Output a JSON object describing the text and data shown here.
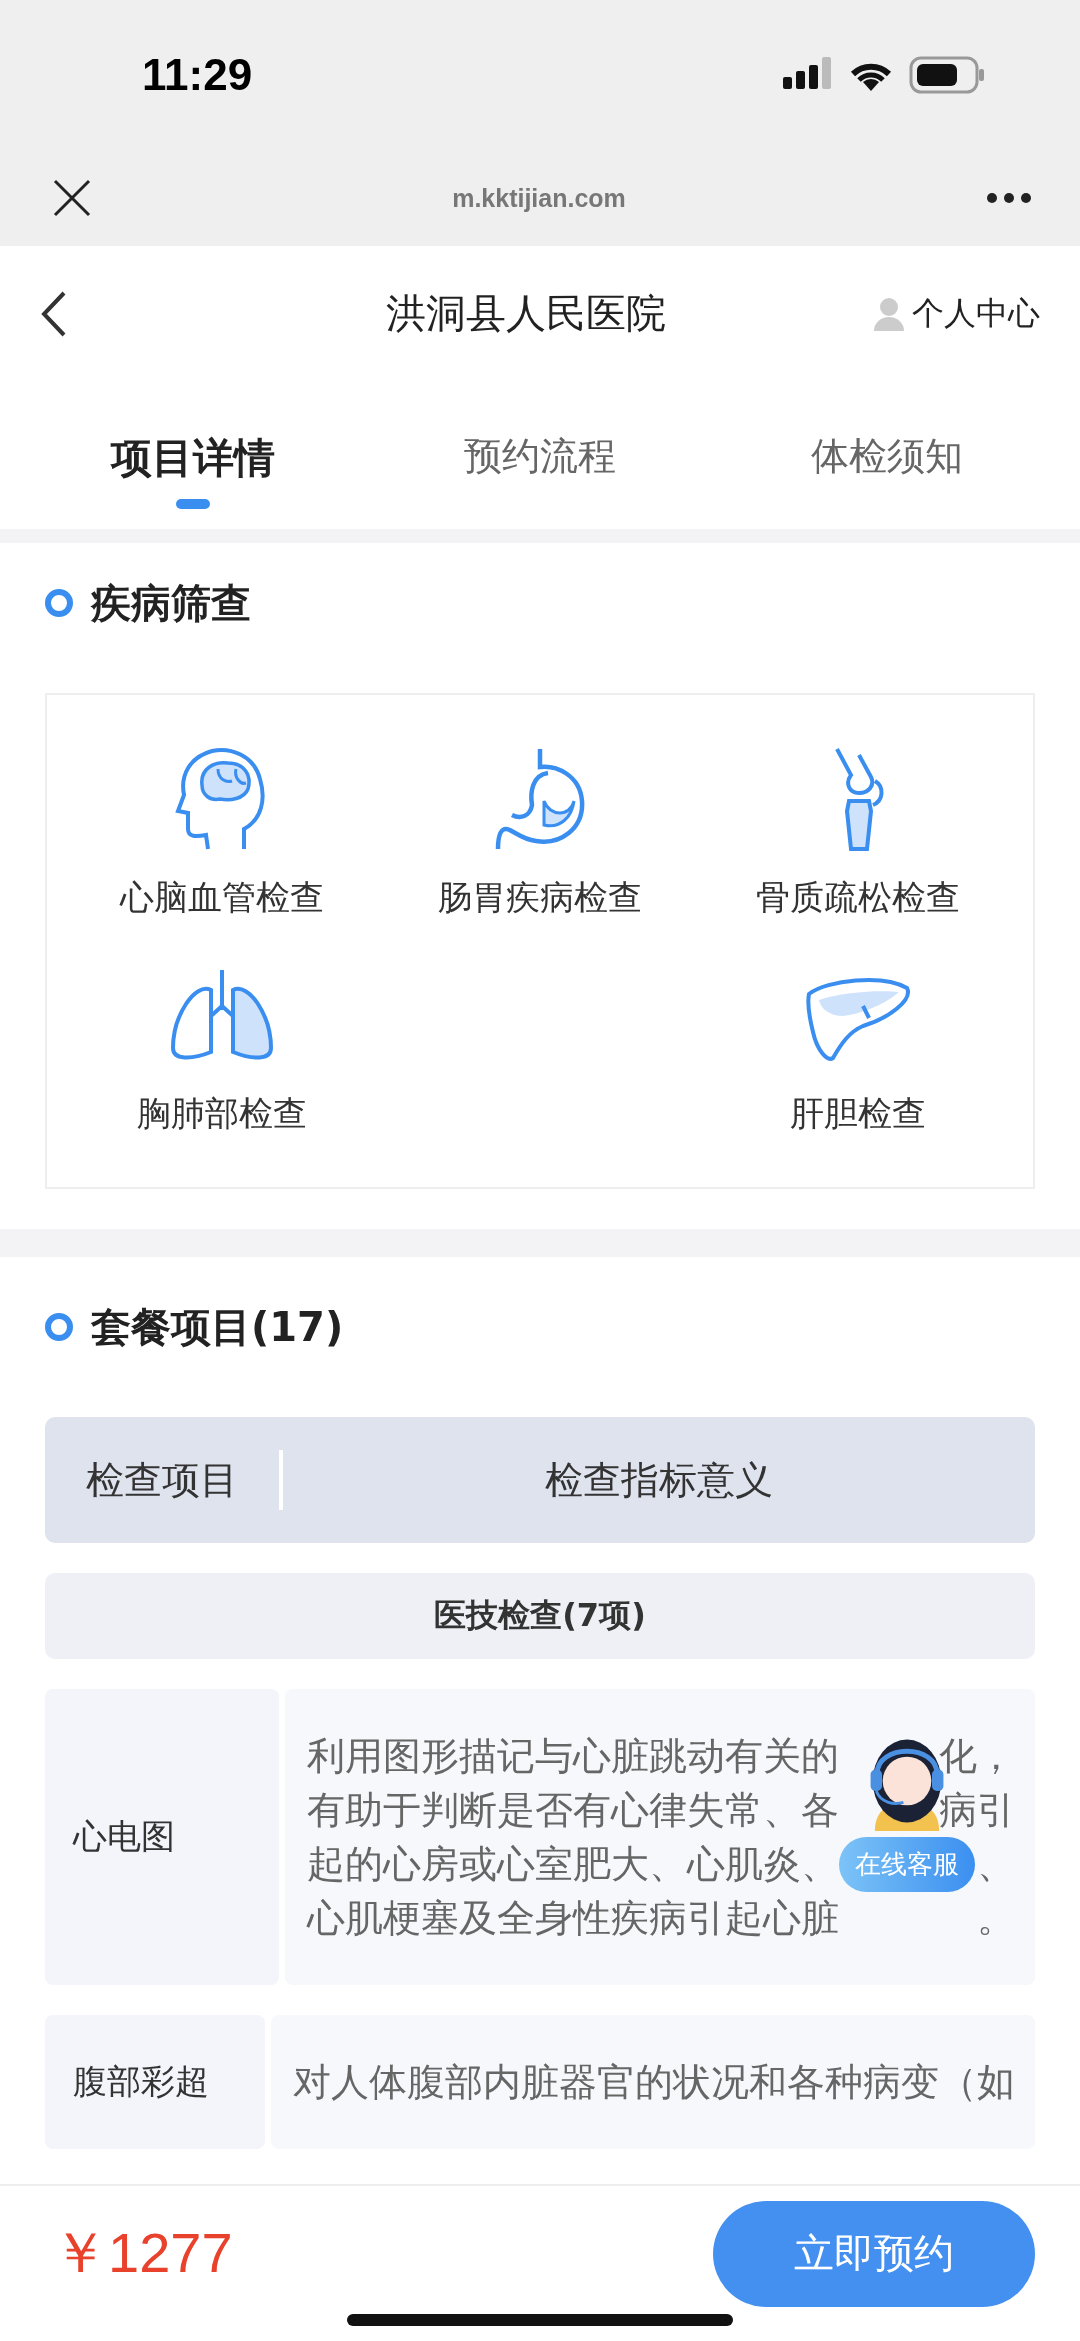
{
  "status_bar": {
    "time": "11:29"
  },
  "browser": {
    "url": "m.kktijian.com"
  },
  "header": {
    "title": "洪洞县人民医院",
    "user_link": "个人中心"
  },
  "tabs": [
    {
      "label": "项目详情",
      "selected": true
    },
    {
      "label": "预约流程",
      "selected": false
    },
    {
      "label": "体检须知",
      "selected": false
    }
  ],
  "screening": {
    "title": "疾病筛查",
    "items": [
      {
        "label": "心脑血管检查",
        "kind": "brain"
      },
      {
        "label": "肠胃疾病检查",
        "kind": "stomach"
      },
      {
        "label": "骨质疏松检查",
        "kind": "bone"
      },
      {
        "label": "胸肺部检查",
        "kind": "lungs"
      },
      {
        "label": "肝胆检查",
        "kind": "liver"
      }
    ]
  },
  "package": {
    "title": "套餐项目(17)",
    "columns": [
      "检查项目",
      "检查指标意义"
    ],
    "groups": [
      {
        "title": "医技检查(7项)",
        "rows": [
          {
            "name": "心电图",
            "description_lines": [
              [
                "利用图形描记与心脏跳动有关的",
                "化，"
              ],
              [
                "有助于判断是否有心律失常、各",
                "病引"
              ],
              [
                "起的心房或心室肥大、心肌炎、",
                "、"
              ],
              [
                "心肌梗塞及全身性疾病引起心脏",
                "。"
              ]
            ]
          },
          {
            "name": "腹部彩超",
            "description_lines": [
              [
                "对人体腹部内脏器官的状况和各种病变（如"
              ]
            ]
          }
        ]
      }
    ]
  },
  "support": {
    "label": "在线客服"
  },
  "footer": {
    "price": "￥1277",
    "button": "立即预约"
  }
}
